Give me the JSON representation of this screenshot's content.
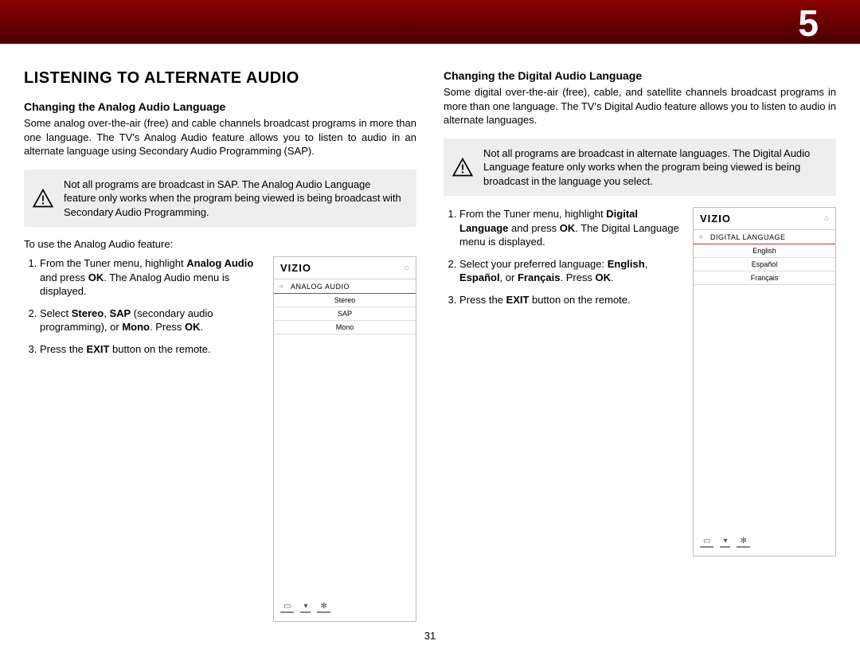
{
  "chapter_number": "5",
  "page_number": "31",
  "left": {
    "main_title": "LISTENING TO ALTERNATE AUDIO",
    "sub_title": "Changing the Analog Audio Language",
    "paragraph": "Some analog over-the-air (free) and cable channels broadcast programs in more than one language. The TV's Analog Audio feature allows you to listen to audio in an alternate language using Secondary Audio Programming (SAP).",
    "note": "Not all programs are broadcast in SAP. The Analog Audio Language feature only works when the program being viewed is being broadcast with Secondary Audio Programming.",
    "list_intro": "To use the Analog Audio feature:",
    "step1_pre": "From the Tuner menu, highlight ",
    "step1_bold1": "Analog Audio",
    "step1_mid": " and press ",
    "step1_bold2": "OK",
    "step1_post": ". The Analog Audio menu is displayed.",
    "step2_pre": "Select ",
    "step2_bold1": "Stereo",
    "step2_mid1": ", ",
    "step2_bold2": "SAP",
    "step2_mid2": " (secondary audio programming), or ",
    "step2_bold3": "Mono",
    "step2_mid3": ". Press ",
    "step2_bold4": "OK",
    "step2_post": ".",
    "step3_pre": "Press the ",
    "step3_bold": "EXIT",
    "step3_post": " button on the remote.",
    "tv": {
      "logo": "VIZIO",
      "section": "ANALOG AUDIO",
      "options": [
        "Stereo",
        "SAP",
        "Mono"
      ]
    }
  },
  "right": {
    "sub_title": "Changing the Digital Audio Language",
    "paragraph": "Some digital over-the-air (free), cable, and satellite channels broadcast programs in more than one language. The TV's Digital Audio feature allows you to listen to audio in alternate languages.",
    "note": "Not all programs are broadcast in alternate languages. The Digital Audio Language feature only works when the program being viewed is being broadcast in the language you select.",
    "step1_pre": "From the Tuner menu, highlight ",
    "step1_bold1": "Digital Language",
    "step1_mid": " and press ",
    "step1_bold2": "OK",
    "step1_post": ". The Digital Language menu is displayed.",
    "step2_pre": "Select your preferred language: ",
    "step2_bold1": "English",
    "step2_mid1": ", ",
    "step2_bold2": "Español",
    "step2_mid2": ", or ",
    "step2_bold3": "Français",
    "step2_mid3": ". Press ",
    "step2_bold4": "OK",
    "step2_post": ".",
    "step3_pre": "Press the ",
    "step3_bold": "EXIT",
    "step3_post": " button on the remote.",
    "tv": {
      "logo": "VIZIO",
      "section": "DIGITAL LANGUAGE",
      "options": [
        "English",
        "Español",
        "Français"
      ]
    }
  }
}
